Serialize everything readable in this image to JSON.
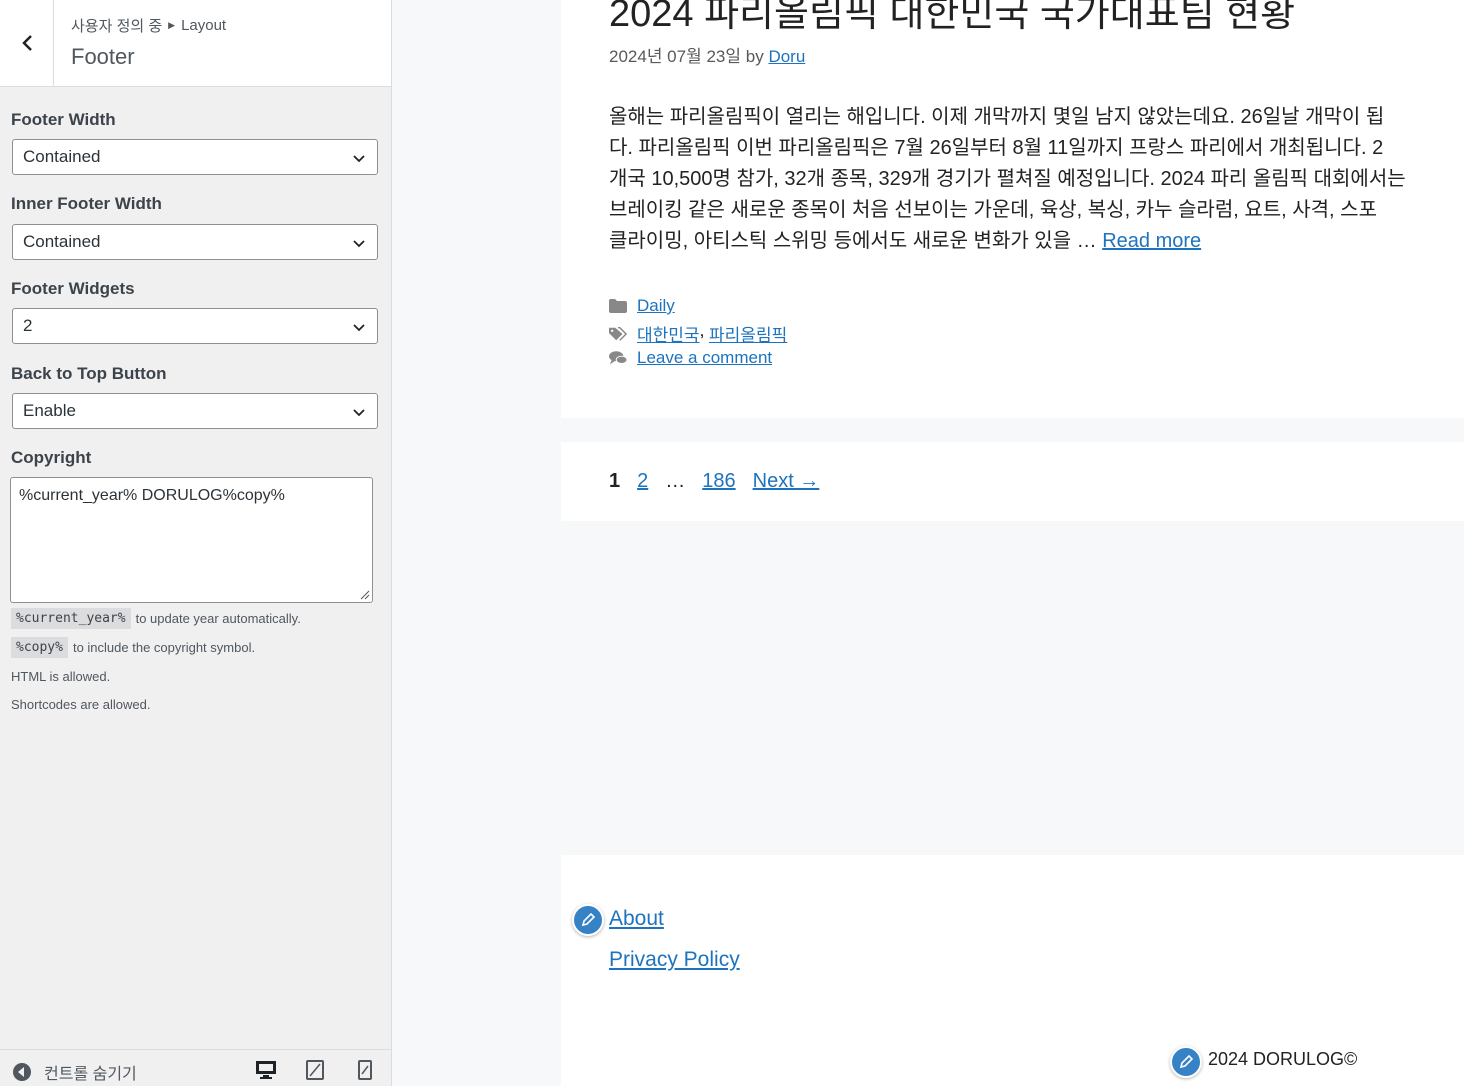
{
  "sidebar": {
    "breadcrumb_parent": "사용자 정의 중",
    "breadcrumb_current": "Layout",
    "section_title": "Footer",
    "fields": {
      "footer_width": {
        "label": "Footer Width",
        "value": "Contained"
      },
      "inner_footer_width": {
        "label": "Inner Footer Width",
        "value": "Contained"
      },
      "footer_widgets": {
        "label": "Footer Widgets",
        "value": "2"
      },
      "back_to_top": {
        "label": "Back to Top Button",
        "value": "Enable"
      },
      "copyright": {
        "label": "Copyright",
        "value": "%current_year% DORULOG%copy%"
      }
    },
    "hints": {
      "year_code": "%current_year%",
      "year_text": "to update year automatically.",
      "copy_code": "%copy%",
      "copy_text": "to include the copyright symbol.",
      "html": "HTML is allowed.",
      "shortcodes": "Shortcodes are allowed."
    },
    "footer": {
      "hide_controls": "컨트롤 숨기기"
    }
  },
  "preview": {
    "post": {
      "title": "2024 파리올림픽 대한민국 국가대표팀 현황",
      "date": "2024년 07월 23일",
      "by": "by",
      "author": "Doru",
      "body_lines": [
        "올해는 파리올림픽이 열리는 해입니다. 이제 개막까지 몇일 남지 않았는데요. 26일날 개막이 됩",
        "다. 파리올림픽 이번 파리올림픽은 7월 26일부터 8월 11일까지 프랑스 파리에서 개최됩니다. 2",
        "개국 10,500명 참가, 32개 종목, 329개 경기가 펼쳐질 예정입니다. 2024 파리 올림픽 대회에서는",
        "브레이킹 같은 새로운 종목이 처음 선보이는 가운데, 육상, 복싱, 카누 슬라럼, 요트, 사격, 스포",
        "클라이밍, 아티스틱 스위밍 등에서도 새로운 변화가 있을 …"
      ],
      "read_more": "Read more",
      "category": "Daily",
      "tags": [
        "대한민국",
        "파리올림픽"
      ],
      "tag_sep": ",",
      "comment": "Leave a comment"
    },
    "pagination": {
      "current": "1",
      "p2": "2",
      "ellipsis": "…",
      "last": "186",
      "next": "Next →"
    },
    "footer": {
      "links": [
        "About",
        "Privacy Policy"
      ],
      "copyright": "2024 DORULOG©"
    }
  },
  "colors": {
    "link": "#1e73be",
    "edit_pen": "#3582c4",
    "sidebar_bg": "#f0f0f1"
  }
}
